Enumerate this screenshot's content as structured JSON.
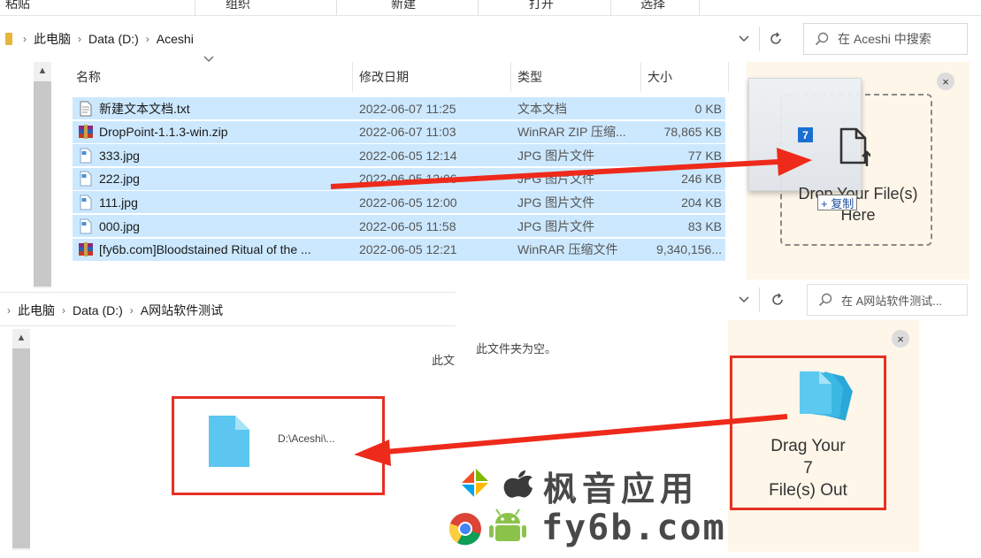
{
  "ribbon": {
    "items": [
      "粘贴",
      "组织",
      "新建",
      "打开",
      "选择"
    ]
  },
  "top_window": {
    "breadcrumb": [
      "此电脑",
      "Data (D:)",
      "Aceshi"
    ],
    "search_placeholder": "在 Aceshi 中搜索",
    "columns": [
      "名称",
      "修改日期",
      "类型",
      "大小"
    ],
    "files": [
      {
        "name": "新建文本文档.txt",
        "date": "2022-06-07 11:25",
        "type": "文本文档",
        "size": "0 KB",
        "icon": "text-file-icon"
      },
      {
        "name": "DropPoint-1.1.3-win.zip",
        "date": "2022-06-07 11:03",
        "type": "WinRAR ZIP 压缩...",
        "size": "78,865 KB",
        "icon": "winrar-archive-icon"
      },
      {
        "name": "333.jpg",
        "date": "2022-06-05 12:14",
        "type": "JPG 图片文件",
        "size": "77 KB",
        "icon": "image-file-icon"
      },
      {
        "name": "222.jpg",
        "date": "2022-06-05 12:06",
        "type": "JPG 图片文件",
        "size": "246 KB",
        "icon": "image-file-icon"
      },
      {
        "name": "111.jpg",
        "date": "2022-06-05 12:00",
        "type": "JPG 图片文件",
        "size": "204 KB",
        "icon": "image-file-icon"
      },
      {
        "name": "000.jpg",
        "date": "2022-06-05 11:58",
        "type": "JPG 图片文件",
        "size": "83 KB",
        "icon": "image-file-icon"
      },
      {
        "name": "[fy6b.com]Bloodstained Ritual of the ...",
        "date": "2022-06-05 12:21",
        "type": "WinRAR 压缩文件",
        "size": "9,340,156...",
        "icon": "winrar-archive-icon"
      }
    ]
  },
  "drop_panel": {
    "badge_count": "7",
    "drop_text_line1": "Drop Your File(s)",
    "drop_text_line2": "Here",
    "copy_tip": "+ 复制",
    "close": "×"
  },
  "bottom_window": {
    "breadcrumb": [
      "此电脑",
      "Data (D:)",
      "A网站软件测试"
    ],
    "search_placeholder": "在 A网站软件测试...",
    "empty_message": "此文件夹为空。",
    "empty_message_fragment": "此文",
    "dropped_path": "D:\\Aceshi\\..."
  },
  "drag_out_panel": {
    "line1": "Drag Your",
    "line2": "7",
    "line3": "File(s) Out",
    "close": "×"
  },
  "watermark": {
    "brand": "枫音应用",
    "url": "fy6b.com"
  },
  "colors": {
    "selection": "#cce8ff",
    "panel_bg": "#fdf6e9",
    "highlight_red": "#e63024",
    "arrow_red": "#ee2a1b",
    "badge_blue": "#1a6fd1"
  }
}
